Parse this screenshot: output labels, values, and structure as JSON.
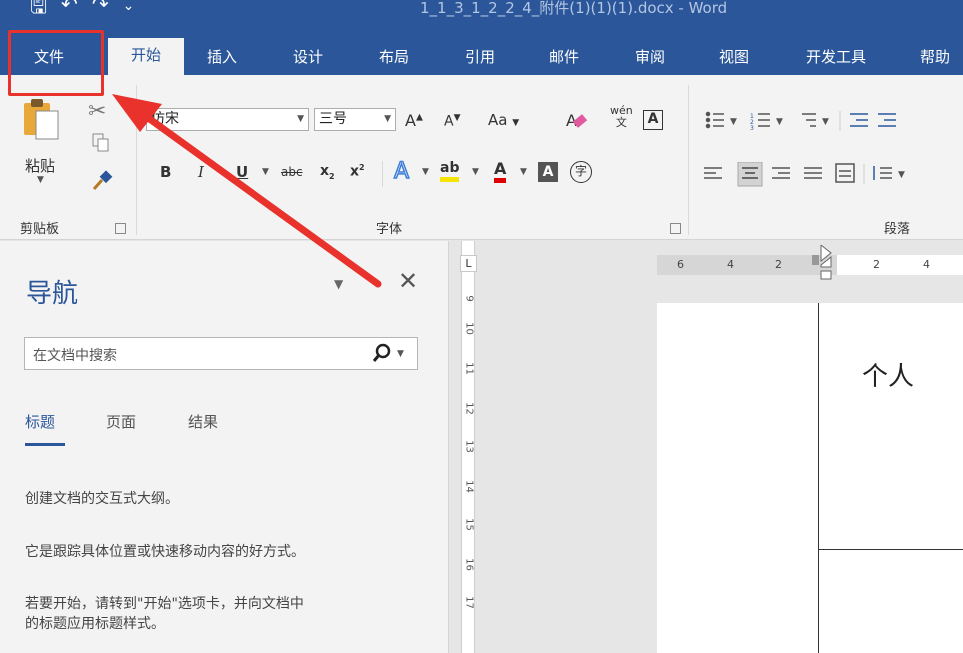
{
  "titlebar": {
    "title": "1_1_3_1_2_2_4_附件(1)(1)(1).docx  -  Word",
    "qat": {
      "save": "🖫",
      "undo": "↶",
      "redo": "↷",
      "more": "⌄"
    }
  },
  "tabs": [
    {
      "label": "文件"
    },
    {
      "label": "开始"
    },
    {
      "label": "插入"
    },
    {
      "label": "设计"
    },
    {
      "label": "布局"
    },
    {
      "label": "引用"
    },
    {
      "label": "邮件"
    },
    {
      "label": "审阅"
    },
    {
      "label": "视图"
    },
    {
      "label": "开发工具"
    },
    {
      "label": "帮助"
    }
  ],
  "ribbon": {
    "clipboard": {
      "paste": "粘贴",
      "group": "剪贴板"
    },
    "font": {
      "font_name": "仿宋",
      "font_size": "三号",
      "grow": "A",
      "shrink": "A",
      "case": "Aa",
      "phonetic": "wén\n文",
      "border_char": "A",
      "bold": "B",
      "italic": "I",
      "underline": "U",
      "strike": "abc",
      "subscript": "x",
      "superscript": "x",
      "text_effect": "A",
      "highlight": "ab",
      "font_color": "A",
      "shading_char": "A",
      "enclose_char": "字",
      "group": "字体"
    },
    "paragraph": {
      "group": "段落"
    }
  },
  "nav": {
    "title": "导航",
    "search_placeholder": "在文档中搜索",
    "tabs": [
      "标题",
      "页面",
      "结果"
    ],
    "lines": [
      "创建文档的交互式大纲。",
      "它是跟踪具体位置或快速移动内容的好方式。",
      "若要开始，请转到\"开始\"选项卡，并向文档中",
      "的标题应用标题样式。"
    ]
  },
  "ruler": {
    "tab_selector": "L",
    "h_numbers": [
      "6",
      "4",
      "2",
      "2",
      "4"
    ],
    "v_numbers": [
      "9",
      "10",
      "11",
      "12",
      "13",
      "14",
      "15",
      "16",
      "17"
    ]
  },
  "document": {
    "text": "个人"
  },
  "colors": {
    "word_blue": "#2b579a",
    "highlight_red": "#e8322b"
  }
}
